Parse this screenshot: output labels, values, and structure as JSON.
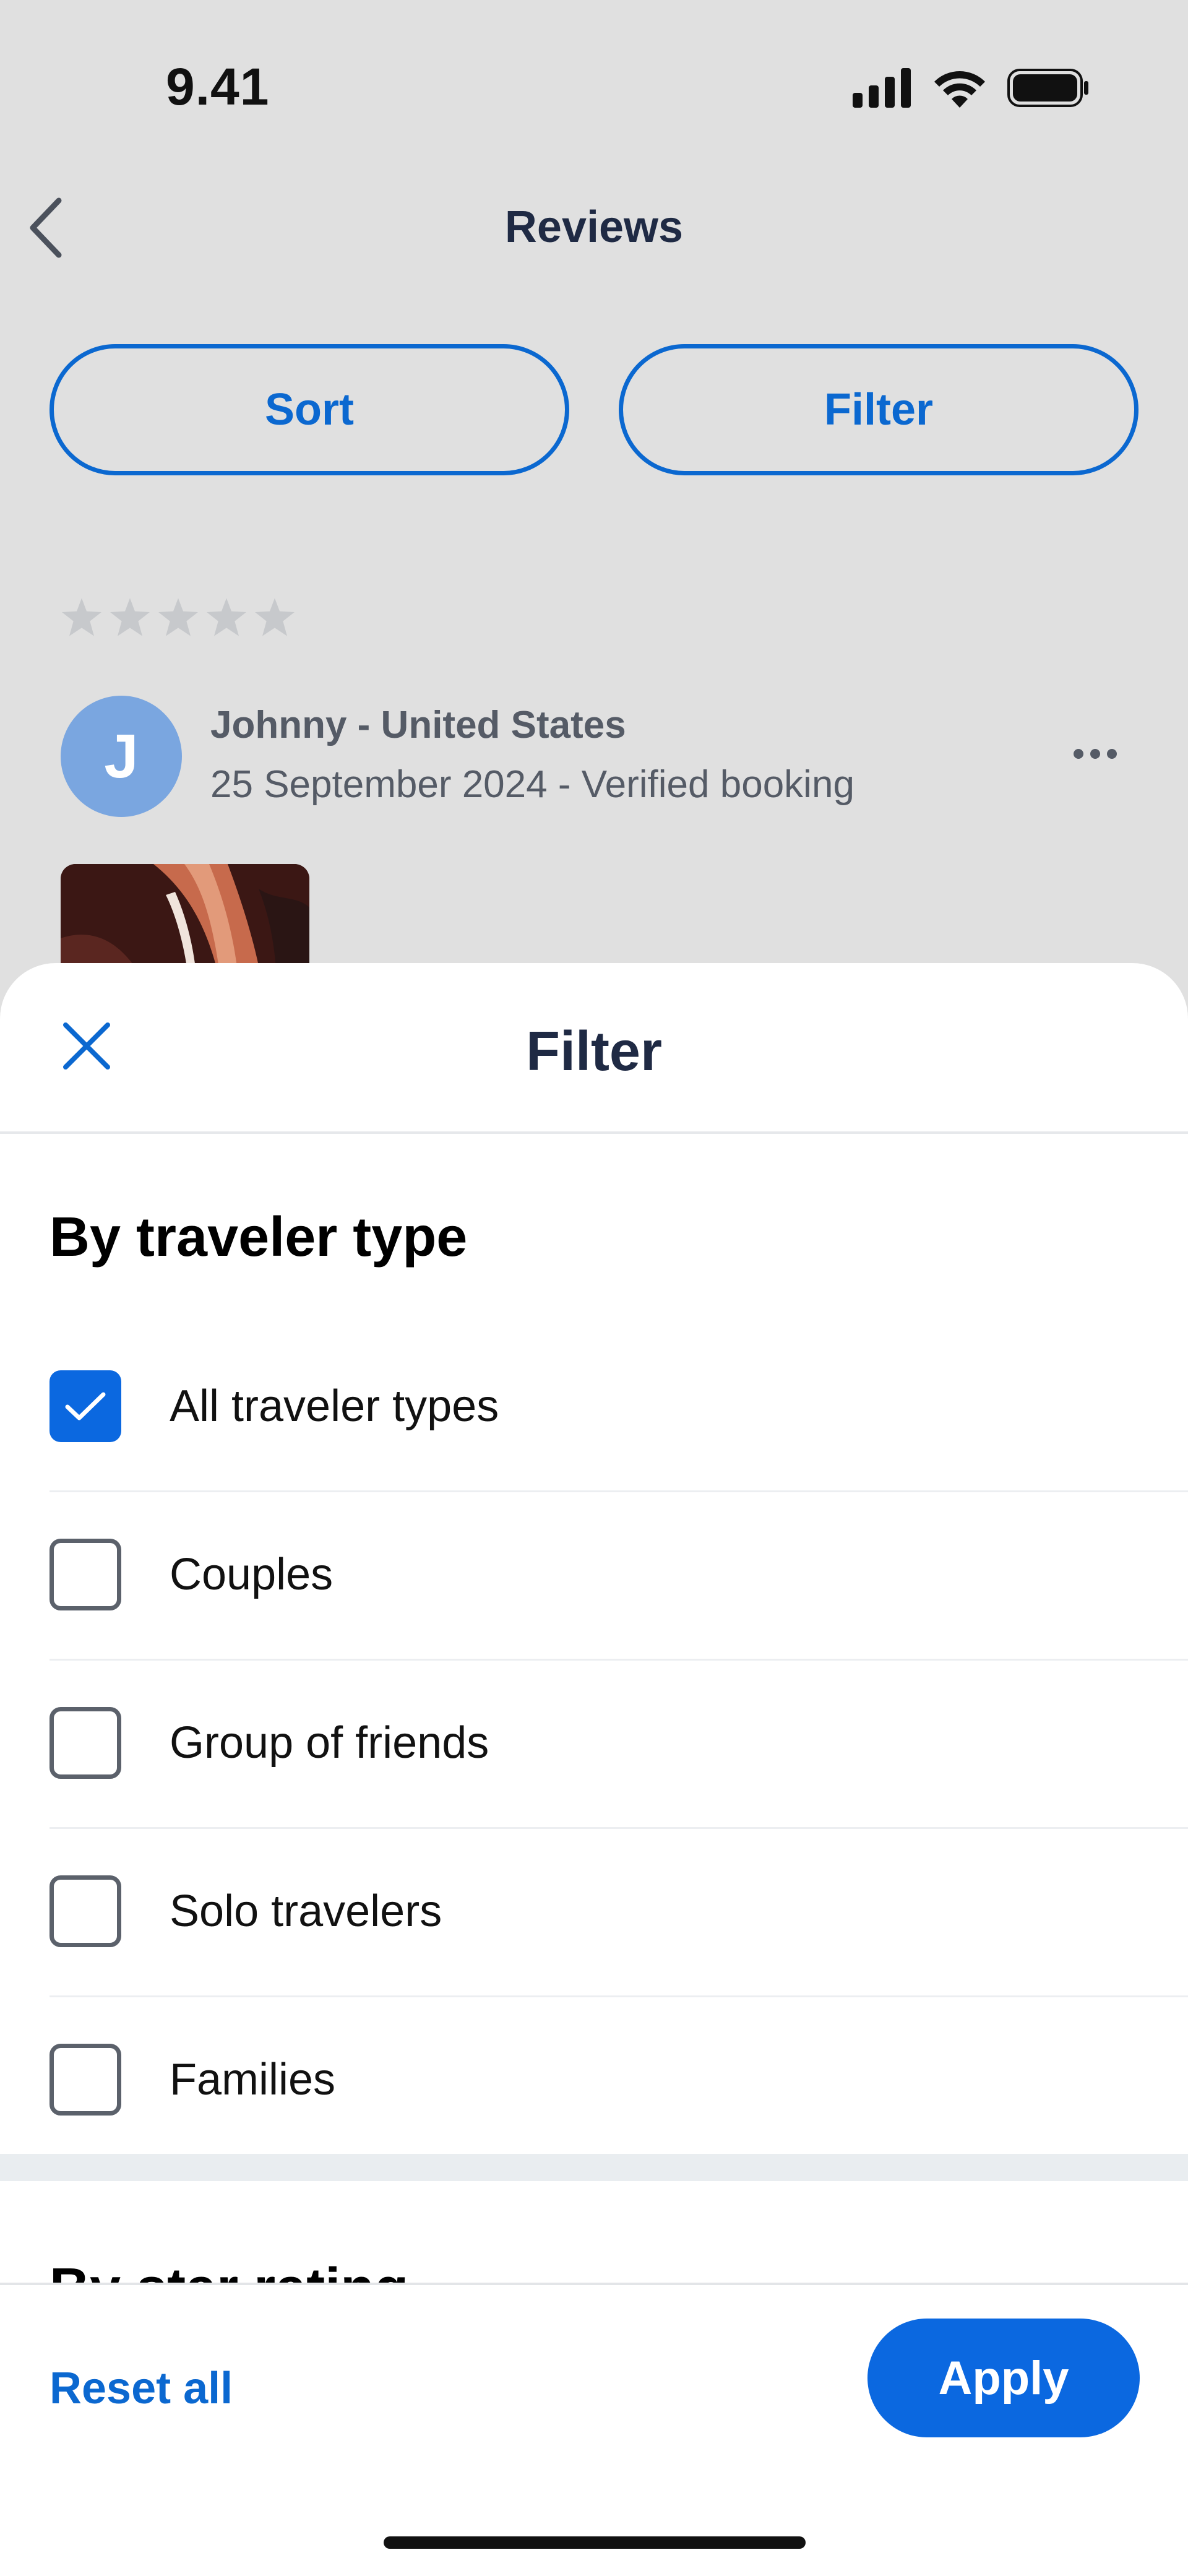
{
  "status_bar": {
    "time": "9.41",
    "icons": [
      "cellular-signal-icon",
      "wifi-icon",
      "battery-icon"
    ]
  },
  "header": {
    "back_icon": "chevron-left-icon",
    "title": "Reviews"
  },
  "actions": {
    "sort_label": "Sort",
    "filter_label": "Filter"
  },
  "review": {
    "rating_stars": 0,
    "rating_max": 5,
    "avatar_initial": "J",
    "reviewer": "Johnny - United States",
    "meta": "25 September 2024 - Verified booking",
    "more_icon": "more-horizontal-icon"
  },
  "filter_sheet": {
    "close_icon": "close-icon",
    "title": "Filter",
    "traveler_section": {
      "heading": "By traveler type",
      "options": [
        {
          "label": "All traveler types",
          "checked": true
        },
        {
          "label": "Couples",
          "checked": false
        },
        {
          "label": "Group of friends",
          "checked": false
        },
        {
          "label": "Solo travelers",
          "checked": false
        },
        {
          "label": "Families",
          "checked": false
        }
      ]
    },
    "rating_section": {
      "heading": "By star rating"
    },
    "footer": {
      "reset_label": "Reset all",
      "apply_label": "Apply"
    }
  },
  "colors": {
    "accent": "#0b68e0",
    "text_dark": "#1f2a44",
    "scrim_background": "#e0e0e0"
  }
}
